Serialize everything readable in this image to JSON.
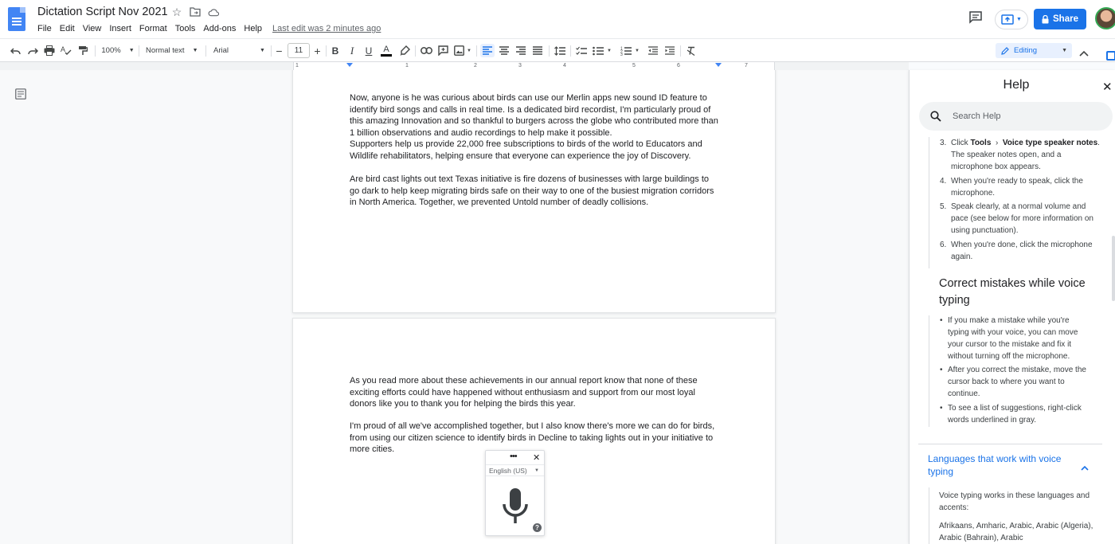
{
  "app": {
    "doc_title": "Dictation Script Nov 2021",
    "menu": [
      "File",
      "Edit",
      "View",
      "Insert",
      "Format",
      "Tools",
      "Add-ons",
      "Help"
    ],
    "last_edit": "Last edit was 2 minutes ago",
    "share_label": "Share"
  },
  "toolbar": {
    "zoom": "100%",
    "style": "Normal text",
    "font": "Arial",
    "font_size": "11",
    "mode": "Editing",
    "icons": [
      "undo-icon",
      "redo-icon",
      "print-icon",
      "spellcheck-icon",
      "paint-format-icon",
      "bold-icon",
      "italic-icon",
      "underline-icon",
      "text-color-icon",
      "highlight-icon",
      "link-icon",
      "comment-icon",
      "image-icon",
      "align-left-icon",
      "align-center-icon",
      "align-right-icon",
      "justify-icon",
      "line-spacing-icon",
      "checklist-icon",
      "bullet-list-icon",
      "numbered-list-icon",
      "decrease-indent-icon",
      "increase-indent-icon",
      "clear-formatting-icon"
    ]
  },
  "ruler": {
    "numbers": [
      "1",
      "1",
      "2",
      "3",
      "4",
      "5",
      "6",
      "7"
    ]
  },
  "document": {
    "p1": "Now, anyone is he was curious about birds can use our Merlin apps new sound ID feature to identify bird songs and calls in real time. Is a dedicated bird recordist, I'm particularly proud of this amazing Innovation and so thankful to burgers across the globe who contributed more than 1 billion observations and audio recordings to help make it possible.",
    "p2": "Supporters help us provide 22,000 free subscriptions to birds of the world to Educators and Wildlife rehabilitators, helping ensure that everyone can experience the joy of Discovery.",
    "p3": "Are bird cast lights out text Texas initiative is fire dozens of businesses with large buildings to go dark to help keep migrating birds safe on their way to one of the busiest migration corridors in North America. Together, we prevented Untold number of deadly collisions.",
    "p4": "As you read more about these achievements in our annual report know that none of these exciting efforts could have happened without enthusiasm and support from our most loyal donors like you to thank you for helping the birds this year.",
    "p5": "I'm proud of all we've accomplished together, but I also know there's more we can do for birds, from using our citizen science to identify birds in Decline to taking lights out in your initiative to more cities."
  },
  "voice_typing": {
    "menu": "•••",
    "language": "English (US)"
  },
  "help": {
    "title": "Help",
    "search_placeholder": "Search Help",
    "steps": [
      {
        "n": "3.",
        "pre": "Click ",
        "b1": "Tools",
        "sep": "›",
        "b2": "Voice type speaker notes",
        "post": ". The speaker notes open, and a microphone box appears."
      },
      {
        "n": "4.",
        "text": "When you're ready to speak, click the microphone."
      },
      {
        "n": "5.",
        "text": "Speak clearly, at a normal volume and pace (see below for more information on using punctuation)."
      },
      {
        "n": "6.",
        "text": "When you're done, click the microphone again."
      }
    ],
    "heading": "Correct mistakes while voice typing",
    "bullets": [
      "If you make a mistake while you're typing with your voice, you can move your cursor to the mistake and fix it without turning off the microphone.",
      "After you correct the mistake, move the cursor back to where you want to continue.",
      "To see a list of suggestions, right-click words underlined in gray."
    ],
    "section_title": "Languages that work with voice typing",
    "section_intro": "Voice typing works in these languages and accents:",
    "section_langs": "Afrikaans, Amharic, Arabic, Arabic (Algeria), Arabic (Bahrain), Arabic"
  },
  "colors": {
    "accent": "#1a73e8",
    "docs_blue": "#4285f4",
    "editing_bg": "#e8f0fe"
  }
}
